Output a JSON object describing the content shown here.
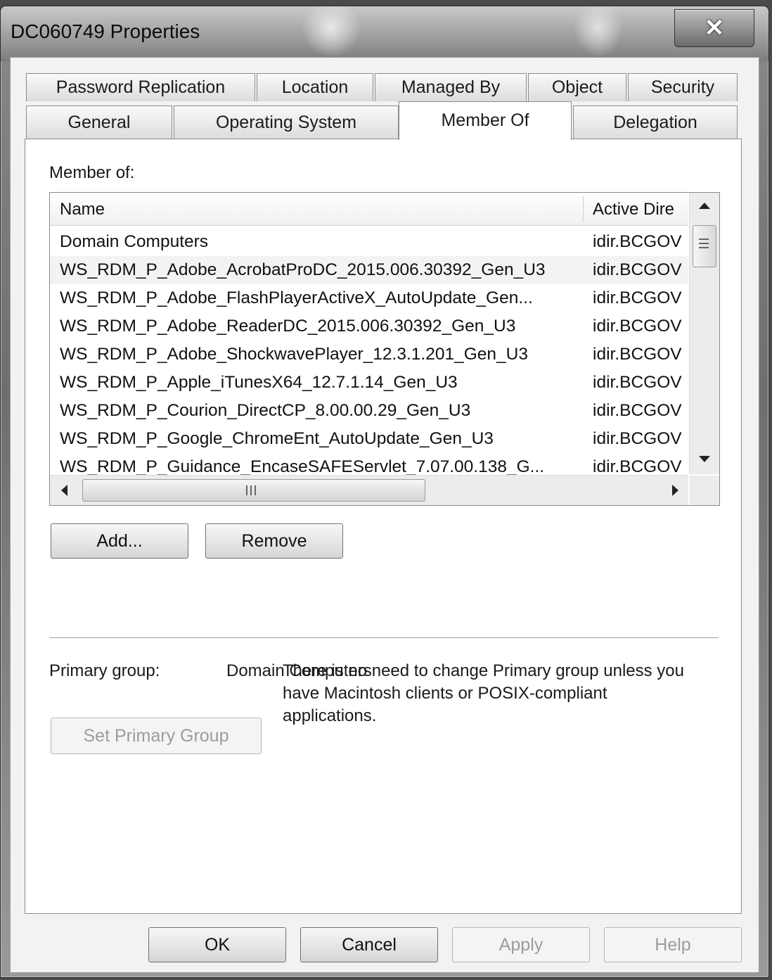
{
  "window": {
    "title": "DC060749 Properties"
  },
  "tabs_row1": [
    "Password Replication",
    "Location",
    "Managed By",
    "Object",
    "Security"
  ],
  "tabs_row2": [
    "General",
    "Operating System",
    "Member Of",
    "Delegation"
  ],
  "active_tab": "Member Of",
  "member_of_label": "Member of:",
  "columns": {
    "name": "Name",
    "ad": "Active Dire"
  },
  "rows": [
    {
      "name": "Domain Computers",
      "ad": "idir.BCGOV"
    },
    {
      "name": "WS_RDM_P_Adobe_AcrobatProDC_2015.006.30392_Gen_U3",
      "ad": "idir.BCGOV"
    },
    {
      "name": "WS_RDM_P_Adobe_FlashPlayerActiveX_AutoUpdate_Gen...",
      "ad": "idir.BCGOV"
    },
    {
      "name": "WS_RDM_P_Adobe_ReaderDC_2015.006.30392_Gen_U3",
      "ad": "idir.BCGOV"
    },
    {
      "name": "WS_RDM_P_Adobe_ShockwavePlayer_12.3.1.201_Gen_U3",
      "ad": "idir.BCGOV"
    },
    {
      "name": "WS_RDM_P_Apple_iTunesX64_12.7.1.14_Gen_U3",
      "ad": "idir.BCGOV"
    },
    {
      "name": "WS_RDM_P_Courion_DirectCP_8.00.00.29_Gen_U3",
      "ad": "idir.BCGOV"
    },
    {
      "name": "WS_RDM_P_Google_ChromeEnt_AutoUpdate_Gen_U3",
      "ad": "idir.BCGOV"
    },
    {
      "name": "WS_RDM_P_Guidance_EncaseSAFEServlet_7.07.00.138_G...",
      "ad": "idir.BCGOV"
    }
  ],
  "buttons": {
    "add": "Add...",
    "remove": "Remove",
    "set_primary": "Set Primary Group",
    "ok": "OK",
    "cancel": "Cancel",
    "apply": "Apply",
    "help": "Help"
  },
  "primary_group": {
    "label": "Primary group:",
    "value": "Domain Computers"
  },
  "note": "There is no need to change Primary group unless you have Macintosh clients or POSIX-compliant applications.",
  "icons": {
    "close": "close-icon",
    "scroll_up": "arrow-up-icon",
    "scroll_down": "arrow-down-icon",
    "scroll_left": "arrow-left-icon",
    "scroll_right": "arrow-right-icon"
  }
}
